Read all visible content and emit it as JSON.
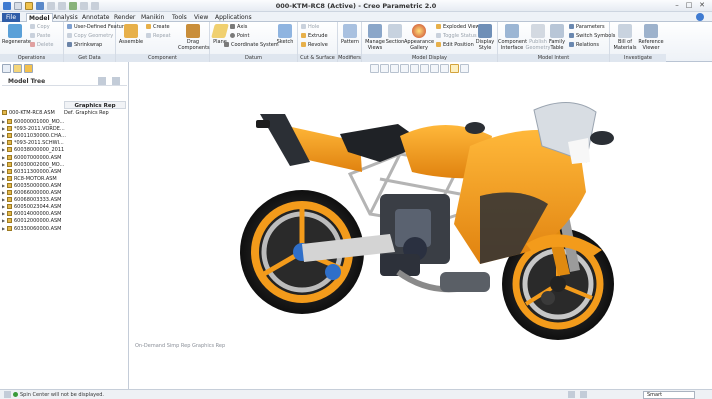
{
  "window": {
    "title": "000-KTM-RC8 (Active) - Creo Parametric 2.0",
    "controls": [
      "–",
      "□",
      "✕"
    ]
  },
  "tabs": [
    "File",
    "Model",
    "Analysis",
    "Annotate",
    "Render",
    "Manikin",
    "Tools",
    "View",
    "Applications"
  ],
  "active_tab": "Model",
  "ribbon": {
    "operations": {
      "label": "Operations",
      "regenerate": "Regenerate",
      "copy": "Copy",
      "paste": "Paste",
      "delete": "Delete"
    },
    "get_data": {
      "label": "Get Data",
      "user_defined_feature": "User-Defined Feature",
      "copy_geometry": "Copy Geometry",
      "shrinkwrap": "Shrinkwrap"
    },
    "component": {
      "label": "Component",
      "assemble": "Assemble",
      "create": "Create",
      "repeat": "Repeat",
      "drag_components": "Drag Components"
    },
    "datum": {
      "label": "Datum",
      "plane": "Plane",
      "axis": "Axis",
      "point": "Point",
      "coordinate_system": "Coordinate System",
      "sketch": "Sketch"
    },
    "cut_surface": {
      "label": "Cut & Surface",
      "hole": "Hole",
      "extrude": "Extrude",
      "revolve": "Revolve"
    },
    "modifiers": {
      "label": "Modifiers",
      "pattern": "Pattern"
    },
    "model_display": {
      "label": "Model Display",
      "manage_views": "Manage Views",
      "section": "Section",
      "appearance_gallery": "Appearance Gallery",
      "exploded_view": "Exploded View",
      "toggle_status": "Toggle Status",
      "edit_position": "Edit Position",
      "display_style": "Display Style"
    },
    "model_intent": {
      "label": "Model Intent",
      "component_interface": "Component Interface",
      "publish_geometry": "Publish Geometry",
      "family_table": "Family Table",
      "parameters": "Parameters",
      "switch_symbols": "Switch Symbols",
      "relations": "Relations"
    },
    "investigate": {
      "label": "Investigate",
      "bill_of_materials": "Bill of Materials",
      "reference_viewer": "Reference Viewer"
    }
  },
  "model_tree": {
    "title": "Model Tree",
    "col_graphics_rep": "Graphics Rep",
    "root": "000-KTM-RC8.ASM",
    "root_rep": "Def. Graphics Rep",
    "items": [
      "60000001000_MO...",
      "*093-2011.VORDE...",
      "60011030000.CHA...",
      "*093-2011.SCHWI...",
      "60038000000_2011",
      "60007000000.ASM",
      "60030002000_MO...",
      "60311300000.ASM",
      "RC8-MOTOR.ASM",
      "60035000000.ASM",
      "60066000000.ASM",
      "60068003333.ASM",
      "60050023044.ASM",
      "60014000000.ASM",
      "60012000000.ASM",
      "60330060000.ASM"
    ]
  },
  "graphics": {
    "caption": "On-Demand Simp Rep Graphics Rep"
  },
  "status": {
    "message": "Spin Center will not be displayed.",
    "filter": "Smart"
  },
  "colors": {
    "body_orange": "#f39b1b",
    "frame_dark": "#2b2f35",
    "ribbon_bg": "#eef2f7",
    "file_tab": "#2f5da8"
  }
}
